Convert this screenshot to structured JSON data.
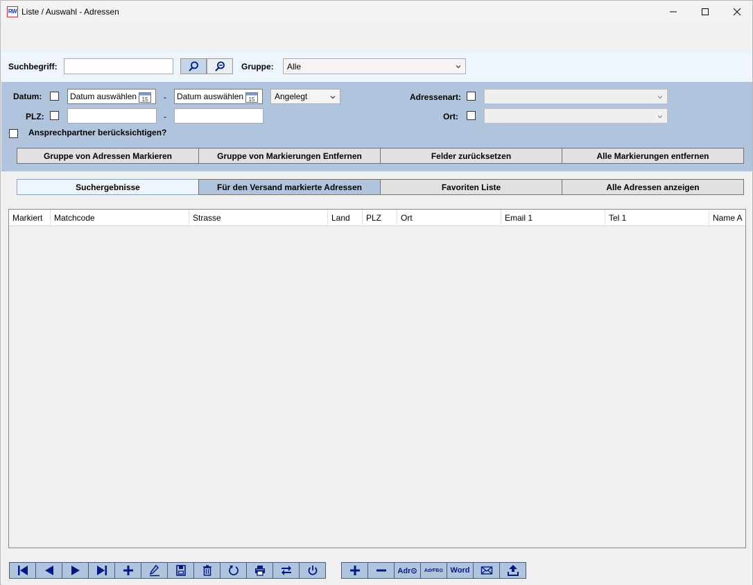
{
  "window": {
    "title": "Liste / Auswahl - Adressen",
    "app_icon_text": "RW"
  },
  "search": {
    "suchbegriff_label": "Suchbegriff:",
    "suchbegriff_value": "",
    "gruppe_label": "Gruppe:",
    "gruppe_value": "Alle"
  },
  "filters": {
    "datum_label": "Datum:",
    "date_from": "Datum auswählen",
    "date_to": "Datum auswählen",
    "date_dash": "-",
    "date_type": "Angelegt",
    "plz_label": "PLZ:",
    "plz_dash": "-",
    "plz_from": "",
    "plz_to": "",
    "ansprech_label": "Ansprechpartner berücksichtigen?",
    "adressenart_label": "Adressenart:",
    "ort_label": "Ort:",
    "calendar_day": "15"
  },
  "actions": [
    "Gruppe von Adressen Markieren",
    "Gruppe von Markierungen Entfernen",
    "Felder zurücksetzen",
    "Alle Markierungen entfernen"
  ],
  "tabs": [
    "Suchergebnisse",
    "Für den Versand markierte Adressen",
    "Favoriten Liste",
    "Alle Adressen anzeigen"
  ],
  "grid": {
    "columns": [
      "Markiert",
      "Matchcode",
      "Strasse",
      "Land",
      "PLZ",
      "Ort",
      "Email 1",
      "Tel 1",
      "Name A"
    ]
  },
  "toolbar": {
    "icons": [
      "first-record-icon",
      "previous-record-icon",
      "next-record-icon",
      "last-record-icon",
      "add-icon",
      "edit-icon",
      "save-icon",
      "delete-icon",
      "refresh-icon",
      "print-icon",
      "swap-icon",
      "power-icon"
    ],
    "adr_label": "Adr⊙",
    "adrfb_label": "AdrFB⊙",
    "word_label": "Word"
  },
  "colors": {
    "panel_blue": "#b0c4de",
    "search_strip": "#eef5fc",
    "icon_navy": "#001a80",
    "active_tab": "#b0c4de",
    "selected_tab": "#eef5fc"
  }
}
